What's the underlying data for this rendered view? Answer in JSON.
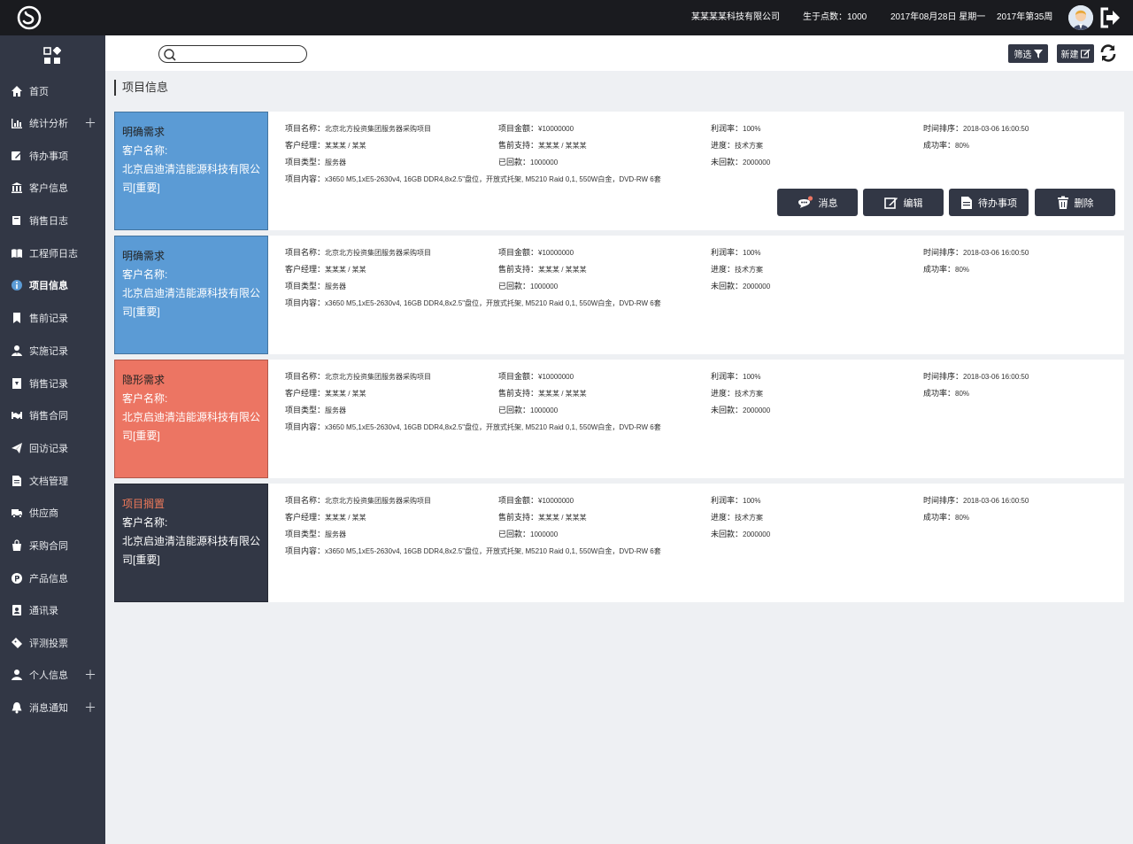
{
  "topbar": {
    "company": "某某某某科技有限公司",
    "points": "生于点数：1000",
    "date": "2017年08月28日  星期一",
    "week": "2017年第35周"
  },
  "sidebar": {
    "items": [
      {
        "label": "首页",
        "icon": "home-icon",
        "plus": false
      },
      {
        "label": "统计分析",
        "icon": "bar-chart-icon",
        "plus": true
      },
      {
        "label": "待办事项",
        "icon": "edit-icon",
        "plus": false
      },
      {
        "label": "客户信息",
        "icon": "bank-icon",
        "plus": false
      },
      {
        "label": "销售日志",
        "icon": "book-icon",
        "plus": false
      },
      {
        "label": "工程师日志",
        "icon": "open-book-icon",
        "plus": false
      },
      {
        "label": "项目信息",
        "icon": "info-icon",
        "plus": false,
        "active": true
      },
      {
        "label": "售前记录",
        "icon": "bookmark-icon",
        "plus": false
      },
      {
        "label": "实施记录",
        "icon": "user-tie-icon",
        "plus": false
      },
      {
        "label": "销售记录",
        "icon": "download-doc-icon",
        "plus": false
      },
      {
        "label": "销售合同",
        "icon": "handshake-icon",
        "plus": false
      },
      {
        "label": "回访记录",
        "icon": "paper-plane-icon",
        "plus": false
      },
      {
        "label": "文档管理",
        "icon": "file-icon",
        "plus": false
      },
      {
        "label": "供应商",
        "icon": "truck-icon",
        "plus": false
      },
      {
        "label": "采购合同",
        "icon": "shopping-bag-icon",
        "plus": false
      },
      {
        "label": "产品信息",
        "icon": "p-circle-icon",
        "plus": false
      },
      {
        "label": "通讯录",
        "icon": "contact-book-icon",
        "plus": false
      },
      {
        "label": "评测投票",
        "icon": "ticket-icon",
        "plus": false
      },
      {
        "label": "个人信息",
        "icon": "user-icon",
        "plus": true
      },
      {
        "label": "消息通知",
        "icon": "bell-icon",
        "plus": true
      }
    ]
  },
  "toolbar": {
    "search_placeholder": "",
    "filter_label": "筛选",
    "new_label": "新建"
  },
  "section_title": "项目信息",
  "field_labels": {
    "name": "项目名称：",
    "amount": "项目金额：",
    "profit": "利润率：",
    "time": "时间排序：",
    "manager": "客户经理：",
    "support": "售前支持：",
    "progress": "进度：",
    "success": "成功率：",
    "type": "项目类型：",
    "received": "已回款：",
    "unreceived": "未回款：",
    "content": "项目内容："
  },
  "actions": {
    "message": "消息",
    "edit": "编辑",
    "todo": "待办事项",
    "delete": "删除"
  },
  "colors": {
    "blue": "#5b9bd5",
    "red": "#ec7563",
    "dark": "#323745",
    "orange_text": "#f07a5a"
  },
  "cards": [
    {
      "status": "明确需求",
      "variant": "blue",
      "customer_label": "客户名称:",
      "customer": "北京启迪清洁能源科技有限公司[重要]",
      "name": "北京北方投资集团服务器采购项目",
      "amount": "¥10000000",
      "profit": "100%",
      "time": "2018-03-06 16:00:50",
      "manager": "某某某 / 某某",
      "support": "某某某 / 某某某",
      "progress": "技术方案",
      "success": "80%",
      "type": "服务器",
      "received": "1000000",
      "unreceived": "2000000",
      "content": "x3650 M5,1xE5-2630v4, 16GB DDR4,8x2.5\"盘位，开放式托架, M5210 Raid 0,1, 550W白金，DVD-RW 6套"
    },
    {
      "status": "明确需求",
      "variant": "blue",
      "customer_label": "客户名称:",
      "customer": "北京启迪清洁能源科技有限公司[重要]",
      "name": "北京北方投资集团服务器采购项目",
      "amount": "¥10000000",
      "profit": "100%",
      "time": "2018-03-06 16:00:50",
      "manager": "某某某 / 某某",
      "support": "某某某 / 某某某",
      "progress": "技术方案",
      "success": "80%",
      "type": "服务器",
      "received": "1000000",
      "unreceived": "2000000",
      "content": "x3650 M5,1xE5-2630v4, 16GB DDR4,8x2.5\"盘位，开放式托架, M5210 Raid 0,1, 550W白金，DVD-RW 6套"
    },
    {
      "status": "隐形需求",
      "variant": "red",
      "customer_label": "客户名称:",
      "customer": "北京启迪清洁能源科技有限公司[重要]",
      "name": "北京北方投资集团服务器采购项目",
      "amount": "¥10000000",
      "profit": "100%",
      "time": "2018-03-06 16:00:50",
      "manager": "某某某 / 某某",
      "support": "某某某 / 某某某",
      "progress": "技术方案",
      "success": "80%",
      "type": "服务器",
      "received": "1000000",
      "unreceived": "2000000",
      "content": "x3650 M5,1xE5-2630v4, 16GB DDR4,8x2.5\"盘位，开放式托架, M5210 Raid 0,1, 550W白金，DVD-RW 6套"
    },
    {
      "status": "项目搁置",
      "variant": "dark",
      "customer_label": "客户名称:",
      "customer": "北京启迪清洁能源科技有限公司[重要]",
      "name": "北京北方投资集团服务器采购项目",
      "amount": "¥10000000",
      "profit": "100%",
      "time": "2018-03-06 16:00:50",
      "manager": "某某某 / 某某",
      "support": "某某某 / 某某某",
      "progress": "技术方案",
      "success": "80%",
      "type": "服务器",
      "received": "1000000",
      "unreceived": "2000000",
      "content": "x3650 M5,1xE5-2630v4, 16GB DDR4,8x2.5\"盘位，开放式托架, M5210 Raid 0,1, 550W白金，DVD-RW 6套"
    }
  ]
}
